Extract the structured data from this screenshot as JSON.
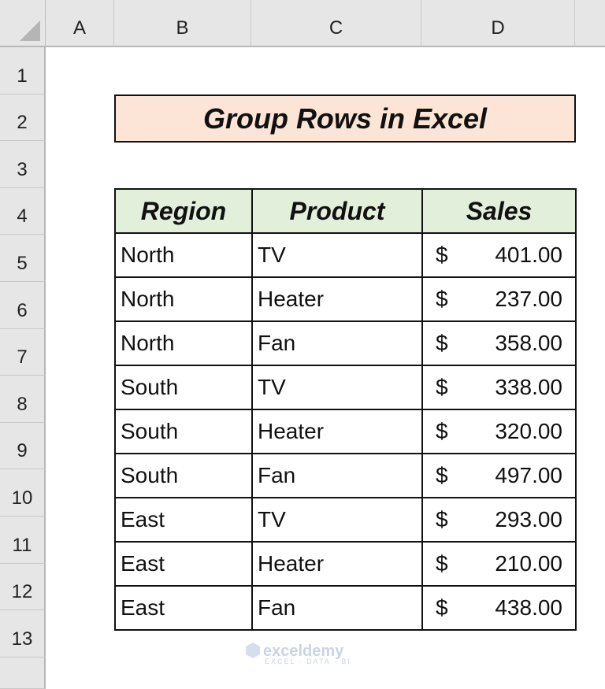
{
  "columns": [
    "A",
    "B",
    "C",
    "D"
  ],
  "rows": [
    "1",
    "2",
    "3",
    "4",
    "5",
    "6",
    "7",
    "8",
    "9",
    "10",
    "11",
    "12",
    "13"
  ],
  "title": "Group Rows in Excel",
  "colors": {
    "title_fill": "#fce4d6",
    "header_fill": "#e2efda"
  },
  "table": {
    "headers": [
      "Region",
      "Product",
      "Sales"
    ],
    "currency_symbol": "$",
    "rows": [
      {
        "region": "North",
        "product": "TV",
        "sales": "401.00"
      },
      {
        "region": "North",
        "product": "Heater",
        "sales": "237.00"
      },
      {
        "region": "North",
        "product": "Fan",
        "sales": "358.00"
      },
      {
        "region": "South",
        "product": "TV",
        "sales": "338.00"
      },
      {
        "region": "South",
        "product": "Heater",
        "sales": "320.00"
      },
      {
        "region": "South",
        "product": "Fan",
        "sales": "497.00"
      },
      {
        "region": "East",
        "product": "TV",
        "sales": "293.00"
      },
      {
        "region": "East",
        "product": "Heater",
        "sales": "210.00"
      },
      {
        "region": "East",
        "product": "Fan",
        "sales": "438.00"
      }
    ]
  },
  "watermark": {
    "name": "exceldemy",
    "tagline": "EXCEL · DATA · BI"
  }
}
